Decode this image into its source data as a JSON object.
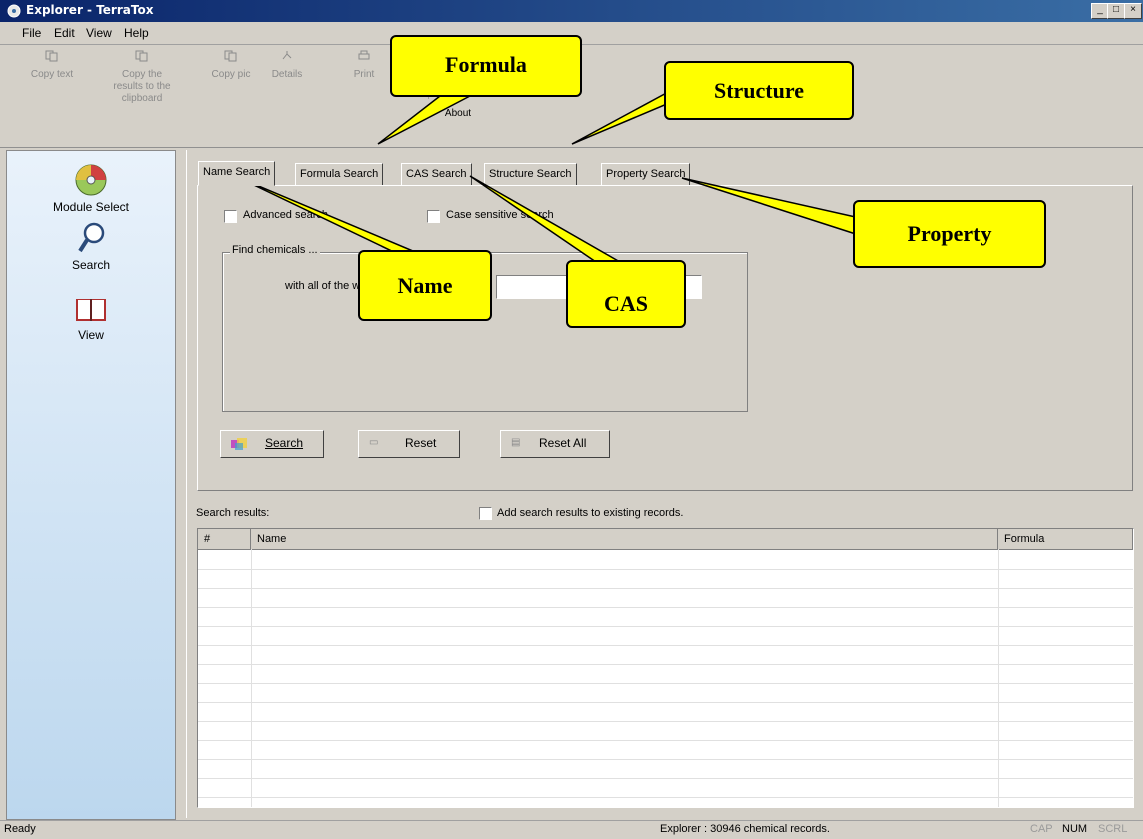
{
  "window": {
    "title": "Explorer - TerraTox"
  },
  "title_buttons": [
    "_",
    "□",
    "×"
  ],
  "menu": [
    "File",
    "Edit",
    "View",
    "Help"
  ],
  "toolbar": [
    {
      "label": "Copy text",
      "icon": "copy-icon"
    },
    {
      "label": "Copy the results to the clipboard",
      "icon": "copy-results-icon"
    },
    {
      "label": "Copy pic",
      "icon": "copy-pic-icon"
    },
    {
      "label": "Details",
      "icon": "details-icon"
    },
    {
      "label": "Print",
      "icon": "print-icon"
    },
    {
      "label": "About",
      "icon": "about-icon"
    }
  ],
  "sidebar": [
    {
      "label": "Module Select",
      "icon": "cd-icon"
    },
    {
      "label": "Search",
      "icon": "magnifier-icon"
    },
    {
      "label": "View",
      "icon": "book-icon"
    }
  ],
  "tabs": [
    "Name Search",
    "Formula Search",
    "CAS Search",
    "Structure Search",
    "Property Search"
  ],
  "options": {
    "advanced": "Advanced search",
    "case": "Case sensitive search"
  },
  "group": {
    "title": "Find chemicals ...",
    "field_label": "with all of the words"
  },
  "buttons": {
    "search": "Search",
    "reset": "Reset",
    "reset_all": "Reset All"
  },
  "results": {
    "label": "Search results:",
    "add_label": "Add search results to existing records.",
    "columns": [
      "#",
      "Name",
      "Formula"
    ]
  },
  "status": {
    "left": "Ready",
    "center": "Explorer : 30946 chemical records.",
    "cap": "CAP",
    "num": "NUM",
    "scrl": "SCRL"
  },
  "callouts": {
    "formula": "Formula",
    "structure": "Structure",
    "property": "Property",
    "name": "Name",
    "cas": "CAS"
  },
  "colors": {
    "callout": "#ffff00",
    "titlebar": "#0a246a",
    "face": "#d4d0c8"
  }
}
